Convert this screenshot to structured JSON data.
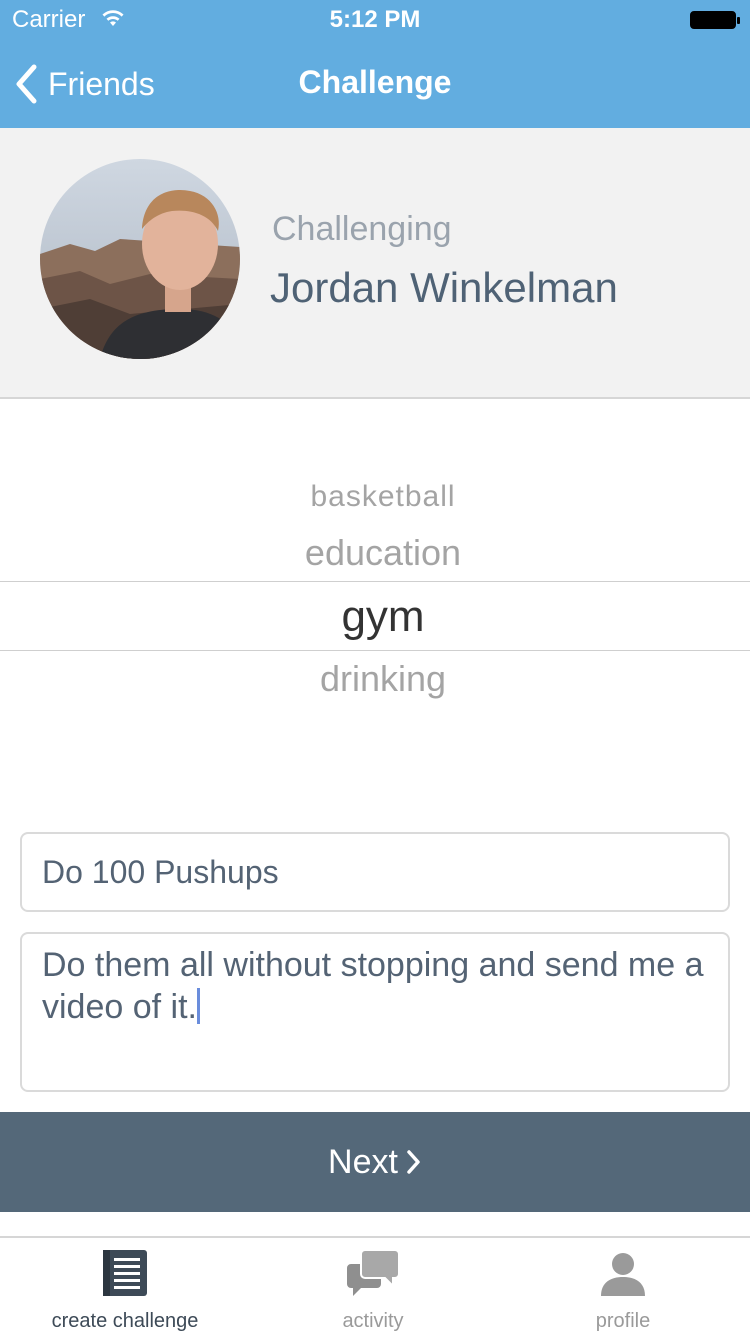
{
  "status_bar": {
    "carrier": "Carrier",
    "time": "5:12 PM"
  },
  "nav": {
    "back_label": "Friends",
    "title": "Challenge"
  },
  "challenger": {
    "label": "Challenging",
    "name": "Jordan Winkelman"
  },
  "picker": {
    "options": [
      "basketball",
      "education",
      "gym",
      "drinking"
    ],
    "selected": "gym"
  },
  "form": {
    "title_value": "Do 100 Pushups",
    "description_value": "Do them all without stopping and send me a video of it."
  },
  "next_button": {
    "label": "Next"
  },
  "tabs": [
    {
      "label": "create challenge",
      "icon": "book-icon",
      "active": true
    },
    {
      "label": "activity",
      "icon": "chat-bubbles-icon",
      "active": false
    },
    {
      "label": "profile",
      "icon": "person-icon",
      "active": false
    }
  ],
  "colors": {
    "nav_bar": "#62ade0",
    "next_button": "#546879",
    "header_background": "#f2f2f2",
    "name_text": "#4f6275"
  }
}
